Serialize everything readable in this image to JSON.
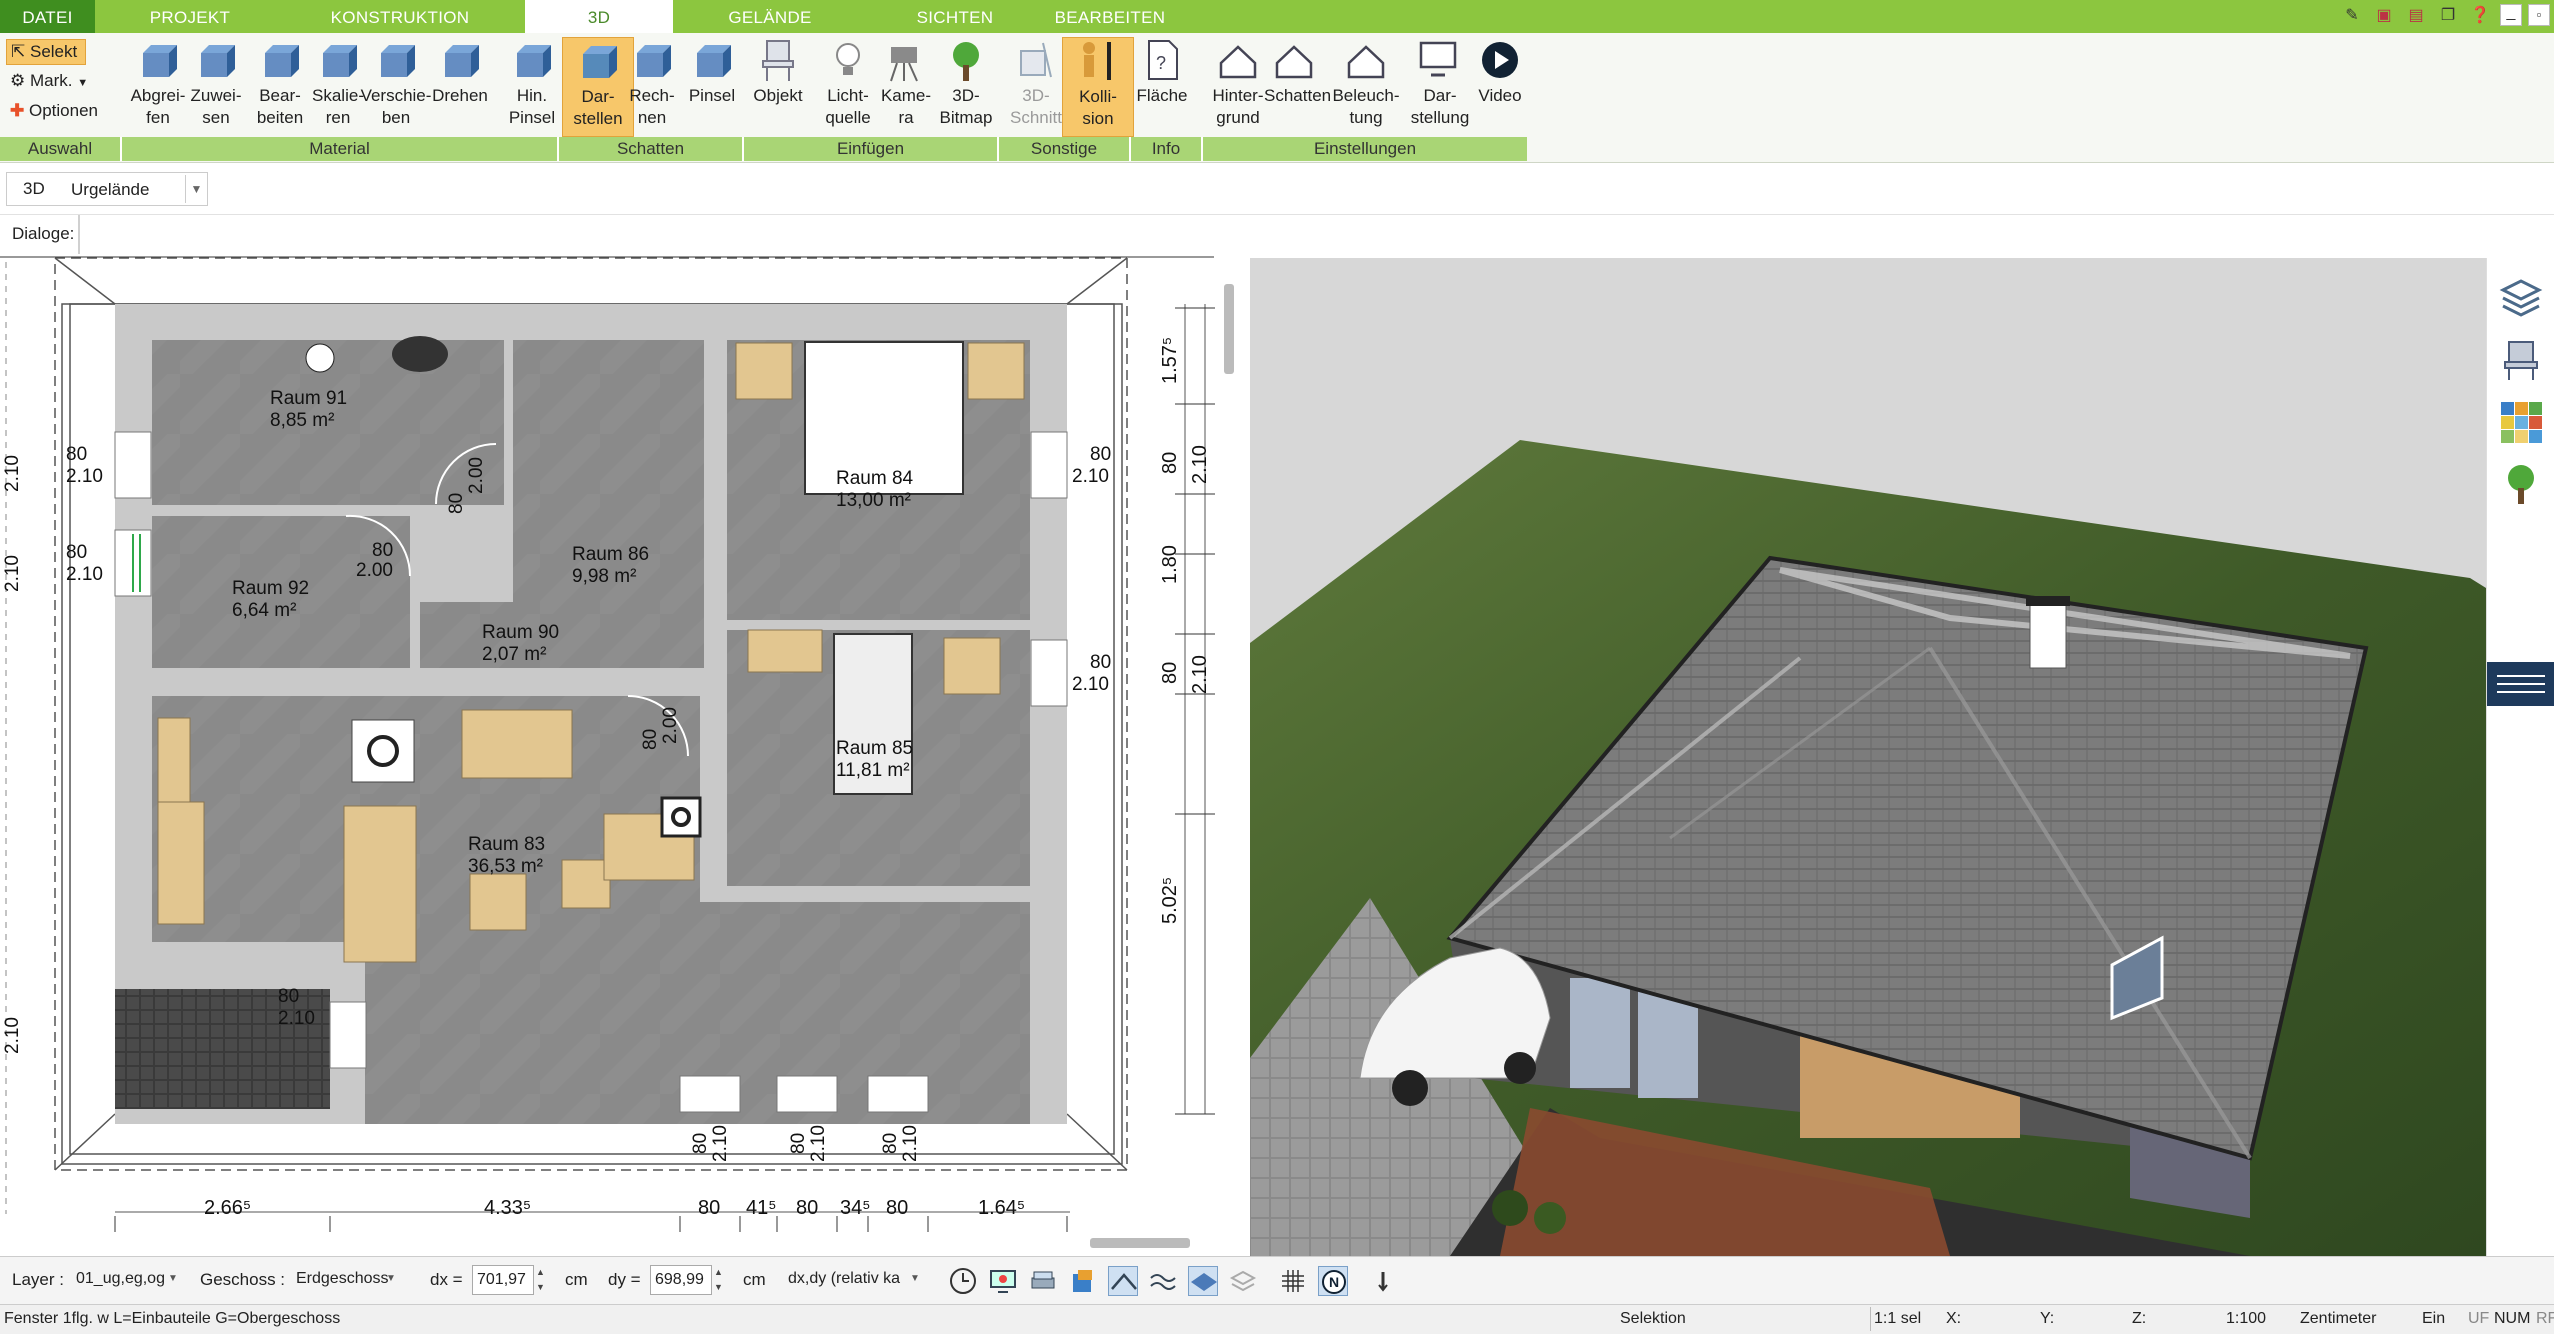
{
  "menu": {
    "tabs": [
      "DATEI",
      "PROJEKT",
      "KONSTRUKTION",
      "3D",
      "GELÄNDE",
      "SICHTEN",
      "BEARBEITEN"
    ],
    "active_tab": "3D"
  },
  "ribbon": {
    "auswahl": {
      "select": "Selekt",
      "mark": "Mark.",
      "options": "Optionen",
      "group": "Auswahl"
    },
    "material": {
      "group": "Material",
      "buttons": [
        "Abgrei-\nfen",
        "Zuwei-\nsen",
        "Bear-\nbeiten",
        "Skalie-\nren",
        "Verschie-\nben",
        "Drehen",
        "Hin.\nPinsel"
      ]
    },
    "schatten": {
      "group": "Schatten",
      "buttons": [
        "Dar-\nstellen",
        "Rech-\nnen",
        "Pinsel"
      ]
    },
    "einfuegen": {
      "group": "Einfügen",
      "buttons": [
        "Objekt",
        "Licht-\nquelle",
        "Kame-\nra",
        "3D-\nBitmap"
      ]
    },
    "sonstige": {
      "group": "Sonstige",
      "buttons": [
        "3D-\nSchnitt",
        "Kolli-\nsion"
      ]
    },
    "info": {
      "group": "Info",
      "buttons": [
        "Fläche"
      ]
    },
    "einstellungen": {
      "group": "Einstellungen",
      "buttons": [
        "Hinter-\ngrund",
        "Schatten",
        "Beleuch-\ntung",
        "Dar-\nstellung",
        "Video"
      ]
    }
  },
  "view_selector": {
    "label": "3D",
    "value": "Urgelände"
  },
  "dialoge_label": "Dialoge:",
  "plan": {
    "rooms": [
      {
        "name": "Raum 91",
        "area": "8,85 m²"
      },
      {
        "name": "Raum 84",
        "area": "13,00 m²"
      },
      {
        "name": "Raum 86",
        "area": "9,98 m²"
      },
      {
        "name": "Raum 92",
        "area": "6,64 m²"
      },
      {
        "name": "Raum 90",
        "area": "2,07 m²"
      },
      {
        "name": "Raum 85",
        "area": "11,81 m²"
      },
      {
        "name": "Raum 83",
        "area": "36,53 m²"
      }
    ],
    "right_dims": [
      "1.57⁵",
      "80",
      "2.10",
      "1.80",
      "80",
      "2.10",
      "5.02⁵"
    ],
    "bottom_dims": [
      "2.66⁵",
      "4.33⁵",
      "80",
      "41⁵",
      "80",
      "34⁵",
      "80",
      "1.64⁵"
    ],
    "opening_labels": {
      "w80": "80",
      "h210": "2.10",
      "h200": "2.00"
    }
  },
  "status": {
    "layer_label": "Layer :",
    "layer_value": "01_ug,eg,og",
    "geschoss_label": "Geschoss :",
    "geschoss_value": "Erdgeschoss",
    "dx_label": "dx =",
    "dx_value": "701,97",
    "dx_unit": "cm",
    "dy_label": "dy =",
    "dy_value": "698,99",
    "dy_unit": "cm",
    "mode_value": "dx,dy (relativ ka"
  },
  "footer": {
    "hint": "Fenster 1flg. w L=Einbauteile G=Obergeschoss",
    "mode": "Selektion",
    "sel": "1:1 sel",
    "x": "X:",
    "y": "Y:",
    "z": "Z:",
    "scale": "1:100",
    "unit": "Zentimeter",
    "ein": "Ein",
    "flags": [
      "UF",
      "NUM",
      "RF"
    ]
  },
  "colors": {
    "menu_green": "#8cc63f",
    "group_green": "#a9d575",
    "selected": "#f7c76a"
  }
}
